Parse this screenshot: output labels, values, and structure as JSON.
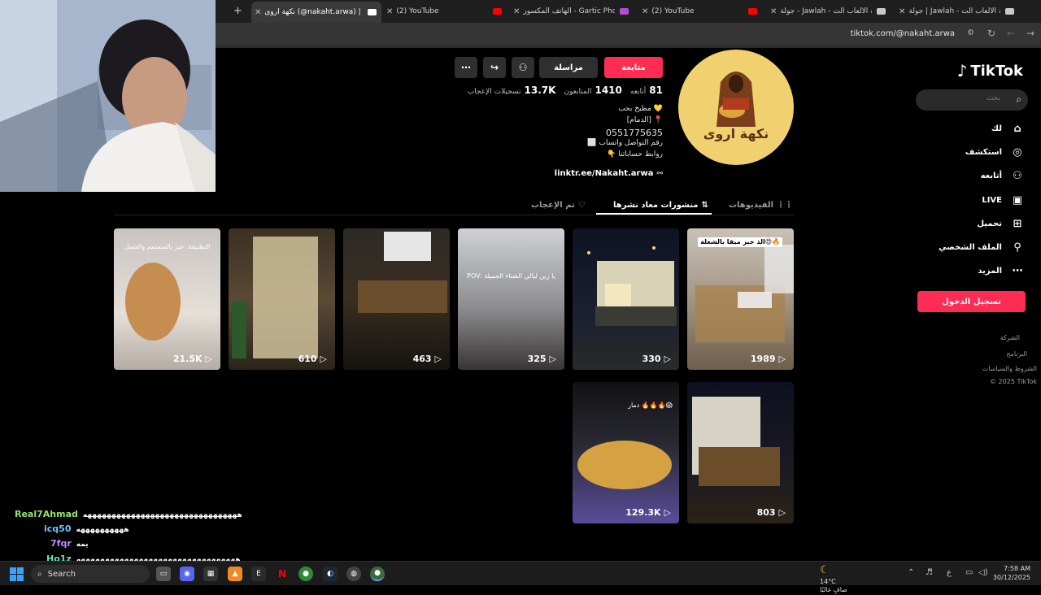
{
  "browser": {
    "tabs": [
      {
        "label": "جولة | Jawlah - منصة الألعاب الت",
        "favicon_color": "#c9c9c9"
      },
      {
        "label": "جولة - Jawlah - منصة الألعاب الت",
        "favicon_color": "#c9c9c9"
      },
      {
        "label": "(2) YouTube",
        "favicon_color": "#ff0000"
      },
      {
        "label": "الهاتف المكسور - Gartic Phone",
        "favicon_color": "#b54bd6"
      },
      {
        "label": "(2) YouTube",
        "favicon_color": "#ff0000"
      },
      {
        "label": "نكهة اروى (@nakaht.arwa) | Tok",
        "favicon_color": "#ffffff"
      }
    ],
    "url": "tiktok.com/@nakaht.arwa"
  },
  "sidebar": {
    "logo": "TikTok",
    "search_placeholder": "بحث",
    "nav": [
      {
        "label": "لك",
        "icon": "home-icon"
      },
      {
        "label": "استكشف",
        "icon": "compass-icon"
      },
      {
        "label": "أتابعه",
        "icon": "user-follow-icon"
      },
      {
        "label": "LIVE",
        "icon": "live-icon"
      },
      {
        "label": "تحميل",
        "icon": "upload-icon"
      },
      {
        "label": "الملف الشخصي",
        "icon": "profile-icon"
      },
      {
        "label": "المزيد",
        "icon": "more-icon"
      }
    ],
    "login_label": "تسجيل الدخول",
    "footer": [
      "الشركة",
      "البرنامج",
      "الشروط والسياسات",
      "© 2025 TikTok"
    ]
  },
  "profile": {
    "avatar_text": "نكهة اروى",
    "follow_label": "متابعة",
    "message_label": "مراسلة",
    "stats": [
      {
        "value": "81",
        "label": "أتابعه"
      },
      {
        "value": "1410",
        "label": "المتابعون"
      },
      {
        "value": "13.7K",
        "label": "تسجيلات الإعجاب"
      }
    ],
    "bio": [
      "💛 مطبخ بحب",
      "📍 [الدمام]",
      "0551775635",
      "رقم التواصل واتساب ⬜",
      "روابط حساباتنا 👇"
    ],
    "link": "linktr.ee/Nakaht.arwa"
  },
  "tabs": [
    {
      "label": "الفيديوهات",
      "icon": "grid-icon"
    },
    {
      "label": "منشورات معاد نشرها",
      "icon": "repost-icon"
    },
    {
      "label": "تم الإعجاب",
      "icon": "heart-off-icon"
    }
  ],
  "videos": [
    {
      "views": "1989",
      "caption": "الذ خبز ميفا بالشعلة😍🔥"
    },
    {
      "views": "330",
      "caption": ""
    },
    {
      "views": "325",
      "caption": "POV: يا زين ليالي الشتاء الجميلة"
    },
    {
      "views": "463",
      "caption": ""
    },
    {
      "views": "610",
      "caption": ""
    },
    {
      "views": "21.5K",
      "caption": "التطبيقة: خبز بالسمسم والعسل"
    },
    {
      "views": "803",
      "caption": ""
    },
    {
      "views": "129.3K",
      "caption": "دمار 🔥🔥🔥😱"
    }
  ],
  "chat": [
    {
      "user": "Real7Ahmad",
      "color": "#9be36b",
      "message": "ههههههههههههههههههههههههههههههههه"
    },
    {
      "user": "icq50",
      "color": "#6fc3ff",
      "message": "ههههههههههه"
    },
    {
      "user": "7fqr",
      "color": "#c48bff",
      "message": "يمه"
    },
    {
      "user": "Ho1z",
      "color": "#6fe0b4",
      "message": "هههههههههههههههههههههههههههههههههه"
    }
  ],
  "taskbar": {
    "search_label": "Search",
    "weather_temp": "14°C",
    "weather_desc": "صافٍ غالبًا",
    "time": "7:58 AM",
    "date": "30/12/2025",
    "lang": "ع",
    "discord_badge": "9"
  }
}
